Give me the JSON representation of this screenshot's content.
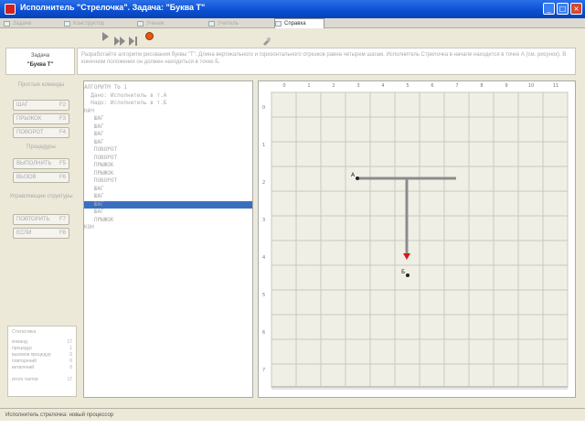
{
  "window": {
    "title": "Исполнитель \"Стрелочка\". Задача: \"Буква Т\"",
    "minimize": "_",
    "maximize": "□",
    "close": "×"
  },
  "tabs": [
    {
      "label": "Задачи"
    },
    {
      "label": "Конструктор"
    },
    {
      "label": "Ученик"
    },
    {
      "label": "Учитель"
    },
    {
      "label": "Справка"
    }
  ],
  "task": {
    "header": "Задача",
    "name": "\"Буква Т\"",
    "description": "Разработайте алгоритм рисования буквы \"Т\". Длина вертикального и горизонтального отрезков равна четырем шагам. Исполнитель Стрелочка в начале находится в точке А (см. рисунок). В конечном положении он должен находиться в точке Б."
  },
  "commands": {
    "simple_group": "Простые команды",
    "step": {
      "label": "ШАГ",
      "key": "F2"
    },
    "jump": {
      "label": "ПРЫЖОК",
      "key": "F3"
    },
    "turn": {
      "label": "ПОВОРОТ",
      "key": "F4"
    },
    "procedures_group": "Процедуры",
    "call": {
      "label": "ВЫПОЛНИТЬ",
      "key": "F5"
    },
    "vyzov": {
      "label": "ВЫЗОВ",
      "key": "F6"
    },
    "control_group": "Управляющие структуры",
    "repeat": {
      "label": "ПОВТОРИТЬ",
      "key": "F7"
    },
    "if": {
      "label": "ЕСЛИ",
      "key": "F8"
    }
  },
  "stats": {
    "title": "Статистика",
    "rows": [
      {
        "label": "команд",
        "value": "17"
      },
      {
        "label": "процедур",
        "value": "1"
      },
      {
        "label": "вызовов процедур",
        "value": "0"
      },
      {
        "label": "повторений",
        "value": "0"
      },
      {
        "label": "ветвлений",
        "value": "0"
      },
      {
        "label": "итого тактов",
        "value": "17"
      }
    ]
  },
  "program": {
    "lines": [
      "АЛГОРИТМ ТЬ 1",
      "  Дано: Исполнитель в т.А",
      "  Надо: Исполнитель в т.Б",
      "НАЧ",
      "   ШАГ",
      "   ШАГ",
      "   ШАГ",
      "   ШАГ",
      "   ПОВОРОТ",
      "   ПОВОРОТ",
      "   ПРЫЖОК",
      "   ПРЫЖОК",
      "   ПОВОРОТ",
      "   ШАГ",
      "   ШАГ",
      "   ШАГ",
      "   ШАГ",
      "   ПРЫЖОК",
      "КОН"
    ],
    "selected_index": 15
  },
  "field": {
    "top_labels": [
      "0",
      "1",
      "2",
      "3",
      "4",
      "5",
      "6",
      "7",
      "8",
      "9",
      "10",
      "11"
    ],
    "left_labels": [
      "0",
      "1",
      "2",
      "3",
      "4",
      "5",
      "6",
      "7"
    ],
    "point_a": "А",
    "point_b": "Б",
    "colors": {
      "grid": "#c8c8c0",
      "line": "#8c8c8c",
      "arrow": "#d81a10",
      "bg": "#f0efe6"
    }
  },
  "statusbar": {
    "text": "Исполнитель стрелочка: новый процессор"
  }
}
